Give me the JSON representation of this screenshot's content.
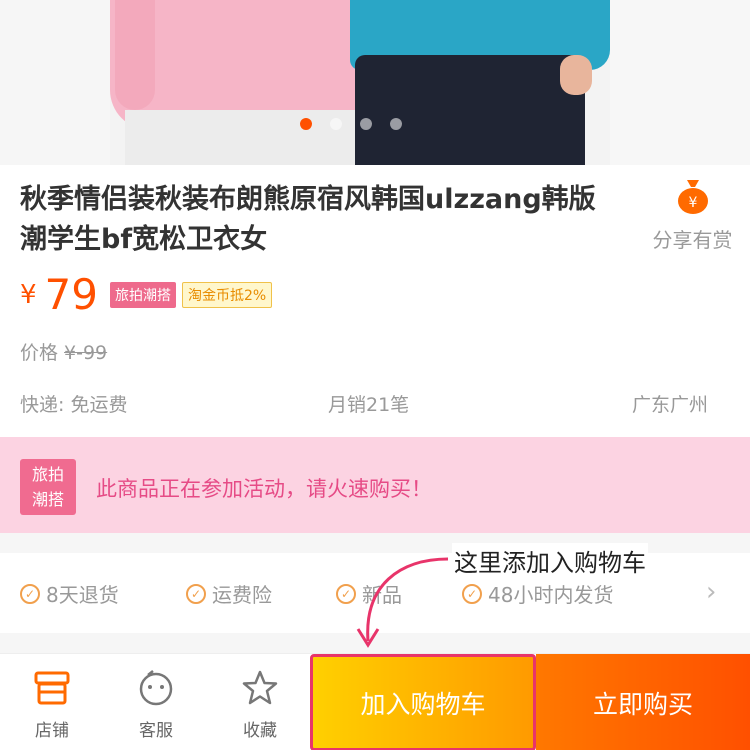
{
  "product": {
    "title": "秋季情侣装秋装布朗熊原宿风韩国ulzzang韩版潮学生bf宽松卫衣女",
    "currency_symbol": "¥",
    "price": "79",
    "tags": [
      "旅拍潮搭",
      "淘金币抵2%"
    ],
    "old_price_label": "价格",
    "old_price": "¥-99",
    "shipping": "快递: 免运费",
    "monthly_sales": "月销21笔",
    "location": "广东广州",
    "image_pages": 4,
    "active_page": 1
  },
  "share": {
    "label": "分享有赏",
    "icon": "money-bag-icon"
  },
  "campaign": {
    "badge": "旅拍潮搭",
    "badge_line1": "旅拍",
    "badge_line2": "潮搭",
    "text": "此商品正在参加活动，请火速购买！"
  },
  "services": [
    {
      "label": "8天退货",
      "icon": "check-circle-icon"
    },
    {
      "label": "运费险",
      "icon": "check-circle-icon"
    },
    {
      "label": "新品",
      "icon": "check-circle-icon"
    },
    {
      "label": "48小时内发货",
      "icon": "check-circle-icon"
    }
  ],
  "annotation": {
    "text": "这里添加入购物车"
  },
  "bottom_bar": {
    "tabs": [
      {
        "label": "店铺",
        "icon": "shop-icon"
      },
      {
        "label": "客服",
        "icon": "customer-service-icon"
      },
      {
        "label": "收藏",
        "icon": "star-icon"
      }
    ],
    "add_to_cart": "加入购物车",
    "buy_now": "立即购买"
  },
  "colors": {
    "accent": "#ff5000",
    "campaign_bg": "#fcd3e2",
    "campaign_text": "#e64b86",
    "cart_button": "#ffb400",
    "buy_button": "#ff5a00",
    "annotation": "#e8346a"
  }
}
